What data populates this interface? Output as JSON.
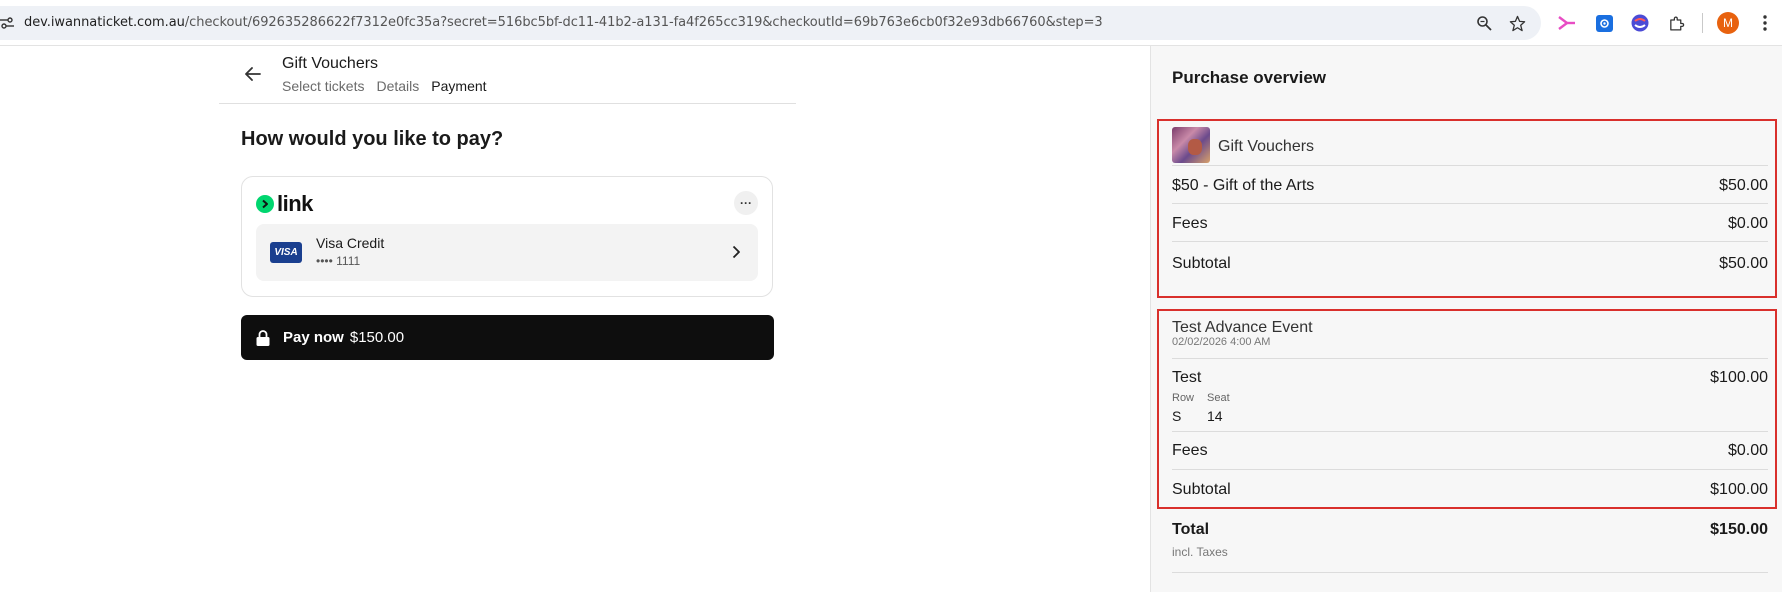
{
  "browser": {
    "url_domain": "dev.iwannaticket.com.au",
    "url_path": "/checkout/692635286622f7312e0fc35a?secret=516bc5bf-dc11-41b2-a131-fa4f265cc319&checkoutId=69b763e6cb0f32e93db66760&step=3",
    "avatar_letter": "M",
    "icons": [
      "tune-icon",
      "zoom-icon",
      "star-icon",
      "extension-arrow-icon",
      "extension-gear-icon",
      "extension-swirl-icon",
      "puzzle-icon",
      "menu-dots-icon"
    ]
  },
  "header": {
    "event_title": "Gift Vouchers",
    "steps": [
      {
        "label": "Select tickets",
        "active": false
      },
      {
        "label": "Details",
        "active": false
      },
      {
        "label": "Payment",
        "active": true
      }
    ]
  },
  "payment": {
    "question": "How would you like to pay?",
    "link_word": "link",
    "card_name": "Visa Credit",
    "card_number": "•••• 1111",
    "visa_badge": "VISA",
    "more": "···",
    "pay_label": "Pay now",
    "pay_amount": "$150.00"
  },
  "overview": {
    "title": "Purchase overview",
    "vouchers": {
      "title": "Gift Vouchers",
      "item_label": "$50 - Gift of the Arts",
      "item_value": "$50.00",
      "fees_label": "Fees",
      "fees_value": "$0.00",
      "subtotal_label": "Subtotal",
      "subtotal_value": "$50.00"
    },
    "event": {
      "name": "Test Advance Event",
      "date": "02/02/2026 4:00 AM",
      "ticket_label": "Test",
      "ticket_value": "$100.00",
      "row_head": "Row",
      "seat_head": "Seat",
      "row_val": "S",
      "seat_val": "14",
      "fees_label": "Fees",
      "fees_value": "$0.00",
      "subtotal_label": "Subtotal",
      "subtotal_value": "$100.00"
    },
    "total_label": "Total",
    "total_value": "$150.00",
    "taxes_note": "incl. Taxes"
  },
  "colors": {
    "highlight_border": "#d9302c",
    "link_green": "#00d66f",
    "pay_button": "#0e0e0e",
    "avatar": "#e8620f"
  }
}
